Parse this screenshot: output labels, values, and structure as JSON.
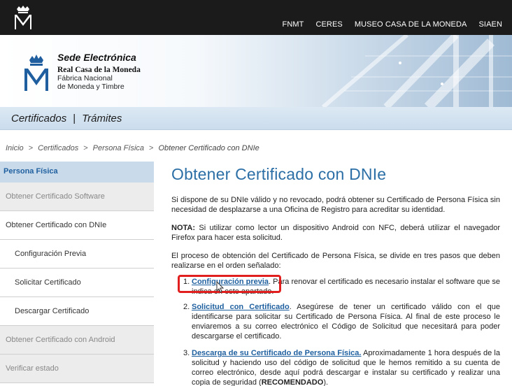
{
  "header": {
    "nav": [
      "FNMT",
      "CERES",
      "MUSEO CASA DE LA MONEDA",
      "SIAEN"
    ]
  },
  "banner": {
    "title": "Sede Electrónica",
    "line1": "Real Casa de la Moneda",
    "line2": "Fábrica Nacional",
    "line3": "de Moneda y Timbre"
  },
  "navstrip": {
    "item1": "Certificados",
    "separator": "|",
    "item2": "Trámites"
  },
  "breadcrumb": {
    "items": [
      "Inicio",
      "Certificados",
      "Persona Física"
    ],
    "current": "Obtener Certificado con DNIe"
  },
  "sidebar": {
    "heading": "Persona Física",
    "items": [
      "Obtener Certificado Software",
      "Obtener Certificado con DNIe",
      "Configuración Previa",
      "Solicitar Certificado",
      "Descargar Certificado",
      "Obtener Certificado con Android",
      "Verificar estado"
    ]
  },
  "main": {
    "title": "Obtener Certificado con DNIe",
    "p1": "Si dispone de su DNIe válido y no revocado, podrá obtener su Certificado de Persona Física sin necesidad de desplazarse a una Oficina de Registro para acreditar su identidad.",
    "p2_bold": "NOTA:",
    "p2": " Si utilizar como lector un dispositivo Android con NFC, deberá utilizar el navegador Firefox para hacer esta solicitud.",
    "p3": "El proceso de obtención del Certificado de Persona Física, se divide en tres pasos que deben realizarse en el orden señalado:",
    "steps": [
      {
        "num": "1.",
        "link": "Configuración previa",
        "text": ". Para renovar el certificado es necesario instalar el software que se indica en este apartado."
      },
      {
        "num": "2.",
        "link": "Solicitud con Certificado",
        "text": ". Asegúrese de tener un certificado válido con el que identificarse para solicitar su Certificado de Persona Física. Al final de este proceso le enviaremos a su correo electrónico el Código de Solicitud que necesitará para poder descargarse el certificado."
      },
      {
        "num": "3.",
        "link": "Descarga de su Certificado de Persona Física.",
        "text": " Aproximadamente 1 hora después de la solicitud y haciendo uso del código de solicitud que le hemos remitido a su cuenta de correo electrónico, desde aquí podrá descargar e instalar su certificado y realizar una copia de seguridad (",
        "bold_tail": "RECOMENDADO",
        "tail": ")."
      }
    ]
  },
  "colors": {
    "topbar": "#1b1b1b",
    "title_blue": "#2c6fa6",
    "link_blue": "#1e5f9f",
    "highlight_red": "#e21f1f"
  }
}
